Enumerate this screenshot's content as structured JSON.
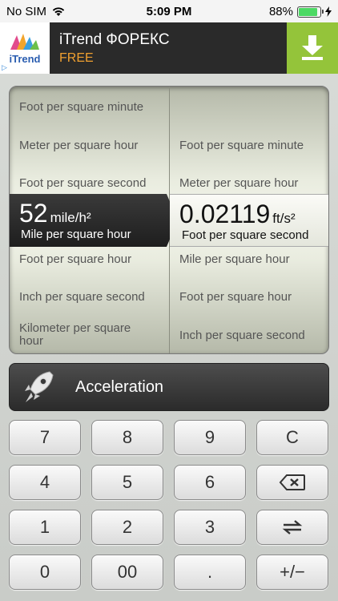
{
  "status_bar": {
    "carrier": "No SIM",
    "time": "5:09 PM",
    "battery": "88%",
    "battery_level": 0.88
  },
  "ad": {
    "logo_text": "iTrend",
    "title": "iTrend ФОРЕКС",
    "subtitle": "FREE"
  },
  "converter": {
    "left_above": [
      "Foot per square minute",
      "Meter per square hour",
      "Foot per square second"
    ],
    "left_selected": {
      "value": "52",
      "unit": "mile/h²",
      "name": "Mile per square hour"
    },
    "left_below": [
      "Foot per square hour",
      "Inch per square second",
      "Kilometer per square hour"
    ],
    "right_above": [
      "Foot per square minute",
      "Meter per square hour"
    ],
    "right_selected": {
      "value": "0.02119",
      "unit": "ft/s²",
      "name": "Foot per square second"
    },
    "right_below": [
      "Mile per square hour",
      "Foot per square hour",
      "Inch per square second"
    ]
  },
  "category": {
    "icon": "rocket-icon",
    "label": "Acceleration"
  },
  "keypad": {
    "rows": [
      [
        "7",
        "8",
        "9",
        "C"
      ],
      [
        "4",
        "5",
        "6",
        "backspace"
      ],
      [
        "1",
        "2",
        "3",
        "swap"
      ],
      [
        "0",
        "00",
        ".",
        "+/−"
      ]
    ]
  },
  "colors": {
    "ad_download": "#94c43a",
    "ad_free": "#f0a030",
    "battery": "#4cd964"
  }
}
